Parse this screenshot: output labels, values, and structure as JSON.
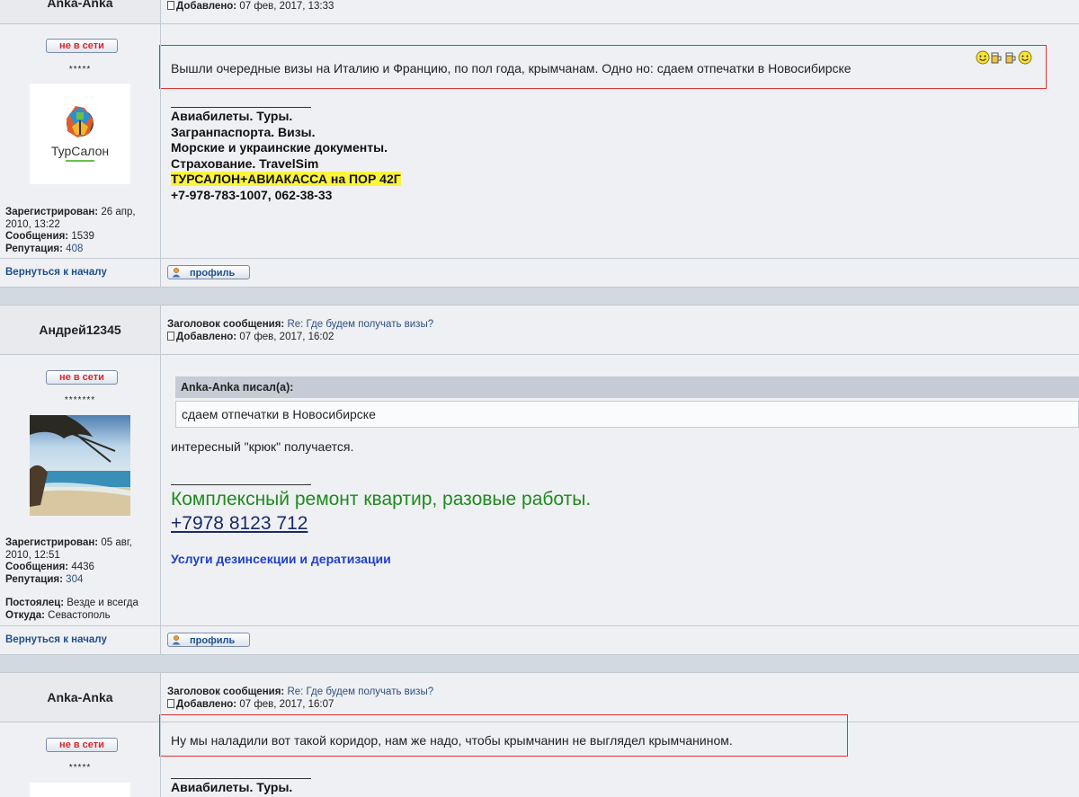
{
  "posts": [
    {
      "author": "Anka-Anka",
      "added_label": "Добавлено:",
      "added_date": "07 фев, 2017, 13:33",
      "status": "не в сети",
      "stars": "*****",
      "avatar_logo": "ТурСалон",
      "stats": {
        "registered_label": "Зарегистрирован:",
        "registered_value": "26 апр, 2010, 13:22",
        "messages_label": "Сообщения:",
        "messages_value": "1539",
        "reputation_label": "Репутация:",
        "reputation_value": "408"
      },
      "text": "Вышли очередные визы на Италию и Францию, по пол года, крымчанам. Одно но: сдаем отпечатки в Новосибирске",
      "signature": [
        "Авиабилеты. Туры.",
        "Загранпаспорта. Визы.",
        "Морские и украинские документы.",
        "Страхование. TravelSim",
        "ТУРСАЛОН+АВИАКАССА на ПОР 42Г",
        "+7-978-783-1007, 062-38-33"
      ],
      "back_link": "Вернуться к началу",
      "profile_button": "профиль"
    },
    {
      "author": "Андрей12345",
      "subject_label": "Заголовок сообщения:",
      "subject_value": "Re: Где будем получать визы?",
      "added_label": "Добавлено:",
      "added_date": "07 фев, 2017, 16:02",
      "status": "не в сети",
      "stars": "*******",
      "stats": {
        "registered_label": "Зарегистрирован:",
        "registered_value": "05 авг, 2010, 12:51",
        "messages_label": "Сообщения:",
        "messages_value": "4436",
        "reputation_label": "Репутация:",
        "reputation_value": "304",
        "resident_label": "Постоялец:",
        "resident_value": "Везде и всегда",
        "from_label": "Откуда:",
        "from_value": "Севастополь"
      },
      "quote_author": "Anka-Anka писал(а):",
      "quote_text": "сдаем отпечатки в Новосибирске",
      "text": "интересный \"крюк\" получается.",
      "signature_green": "Комплексный ремонт квартир, разовые работы.",
      "signature_phone": "+7978 8123 712",
      "signature_link": "Услуги дезинсекции и дератизации",
      "back_link": "Вернуться к началу",
      "profile_button": "профиль"
    },
    {
      "author": "Anka-Anka",
      "subject_label": "Заголовок сообщения:",
      "subject_value": "Re: Где будем получать визы?",
      "added_label": "Добавлено:",
      "added_date": "07 фев, 2017, 16:07",
      "status": "не в сети",
      "stars": "*****",
      "text": "Ну мы наладили вот такой коридор, нам же надо, чтобы крымчанин не выглядел крымчанином.",
      "signature_first": "Авиабилеты. Туры."
    }
  ],
  "colors": {
    "background": "#eff0f3",
    "separator_band": "#d3d9e0",
    "offline_red": "#d8262b",
    "link_blue": "#1f4f8c",
    "signature_green": "#1f8a1f",
    "signature_blue": "#1f3fcc",
    "highlight_yellow": "#fbf43a",
    "annotation_red": "#e03434"
  }
}
